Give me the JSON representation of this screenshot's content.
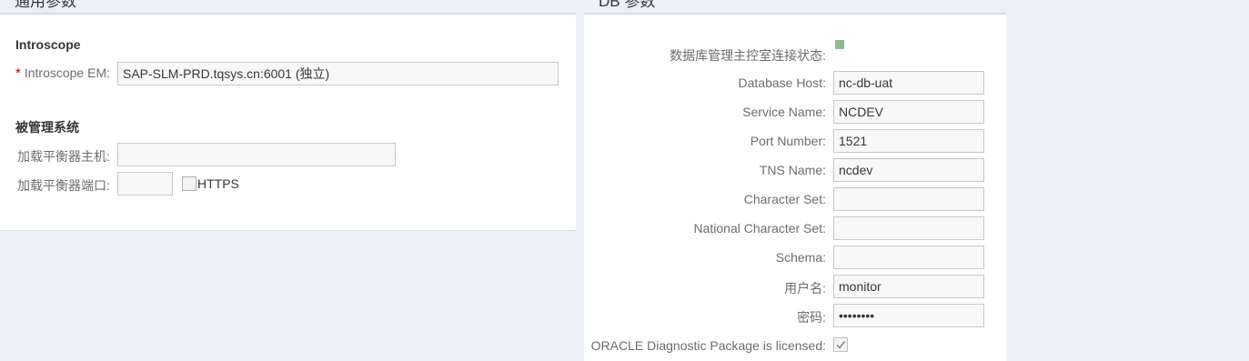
{
  "general": {
    "header": "通用参数",
    "introscope_section": "Introscope",
    "em_required_mark": "*",
    "em_label": "Introscope EM:",
    "em_value": "SAP-SLM-PRD.tqsys.cn:6001 (独立)",
    "managed_section": "被管理系统",
    "lb_host_label": "加载平衡器主机:",
    "lb_host_value": "",
    "lb_port_label": "加载平衡器端口:",
    "lb_port_value": "",
    "https_label": "HTTPS",
    "https_checked": false
  },
  "db": {
    "header": "DB 参数",
    "status_label": "数据库管理主控室连接状态:",
    "status_color": "#8fbc8f",
    "fields": [
      {
        "label": "Database Host:",
        "value": "nc-db-uat"
      },
      {
        "label": "Service Name:",
        "value": "NCDEV"
      },
      {
        "label": "Port Number:",
        "value": "1521"
      },
      {
        "label": "TNS Name:",
        "value": "ncdev"
      },
      {
        "label": "Character Set:",
        "value": ""
      },
      {
        "label": "National Character Set:",
        "value": ""
      },
      {
        "label": "Schema:",
        "value": ""
      },
      {
        "label": "用户名:",
        "value": "monitor"
      },
      {
        "label": "密码:",
        "value": "••••••••"
      }
    ],
    "oracle_label": "ORACLE Diagnostic Package is licensed:",
    "oracle_checked": true
  }
}
